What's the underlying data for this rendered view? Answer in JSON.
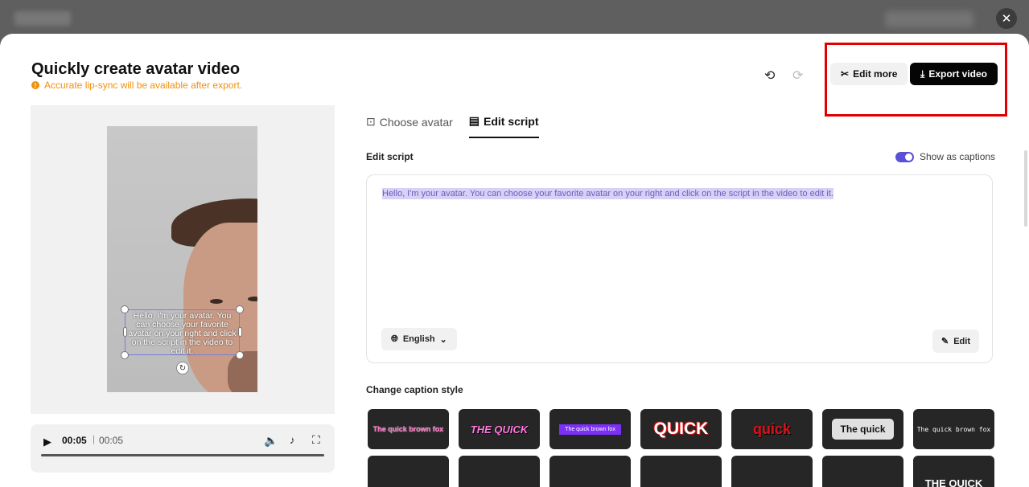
{
  "header": {
    "title": "Quickly create avatar video",
    "warning": "Accurate lip-sync will be available after export.",
    "warning_icon": "!",
    "edit_more_label": "Edit more",
    "export_label": "Export video"
  },
  "preview": {
    "caption": "Hello, I'm your avatar. You can choose your favorite avatar on your right and click on the script in the video to edit it."
  },
  "player": {
    "current_time": "00:05",
    "separator": "|",
    "total_time": "00:05"
  },
  "tabs": [
    {
      "label": "Choose avatar",
      "active": false
    },
    {
      "label": "Edit script",
      "active": true
    }
  ],
  "editor": {
    "section_label": "Edit script",
    "toggle_label": "Show as captions",
    "toggle_on": true,
    "script_text": "Hello, I'm your avatar. You can choose your favorite avatar on your right and click on the script in the video to edit it.",
    "language": "English",
    "edit_label": "Edit"
  },
  "caption_styles": {
    "section_label": "Change caption style",
    "items": [
      "The quick brown fox",
      "THE QUICK",
      "The quick brown fox",
      "QUICK",
      "quick",
      "The quick",
      "The quick brown fox",
      "",
      "",
      "",
      "",
      "",
      "",
      "THE QUICK"
    ]
  },
  "colors": {
    "accent": "#5a4fd6",
    "warning": "#f0900a",
    "highlight": "#e00000"
  }
}
